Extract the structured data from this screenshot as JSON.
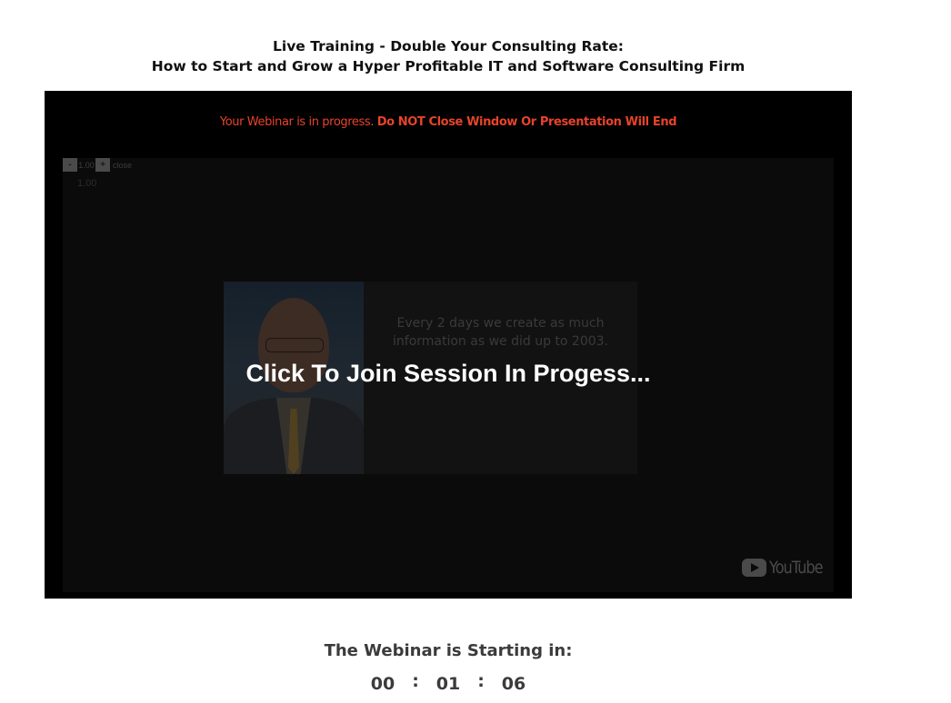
{
  "header": {
    "title_line1": "Live Training - Double Your Consulting Rate:",
    "title_line2": "How to Start and Grow a Hyper Profitable IT and Software Consulting Firm"
  },
  "player": {
    "warning_normal": "Your Webinar is in progress. ",
    "warning_strong": "Do NOT Close Window Or Presentation Will End",
    "zoom": {
      "minus_label": "-",
      "value": "1.00",
      "plus_label": "+",
      "close_label": "close",
      "readout": "1.00"
    },
    "slide_text_line1": "Every 2 days we create as much",
    "slide_text_line2": "information as we did up to 2003.",
    "join_label": "Click To Join Session In Progess...",
    "logo_text": "YouTube",
    "logo_icon": "youtube-play-icon"
  },
  "countdown": {
    "label": "The Webinar is Starting in:",
    "hours": "00",
    "minutes": "01",
    "seconds": "06",
    "separator": ":"
  },
  "colors": {
    "warning": "#e8432a",
    "player_background": "#000000",
    "join_text": "#ffffff",
    "countdown_text": "#3b3b3b"
  }
}
